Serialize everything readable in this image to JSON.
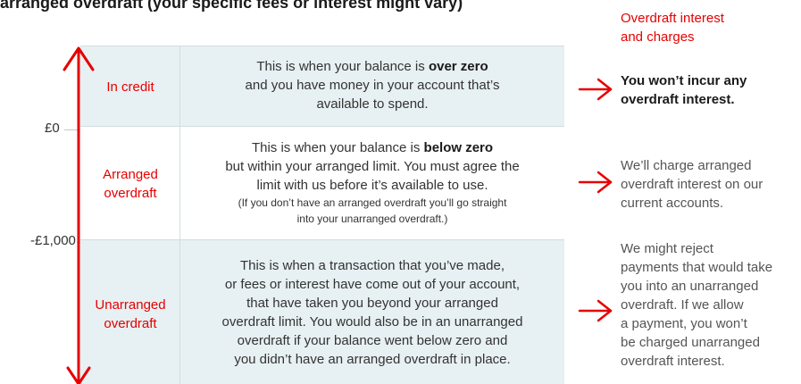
{
  "heading": "arranged overdraft (your specific fees or interest might vary)",
  "column_header": {
    "lines": [
      "Overdraft interest",
      "and charges"
    ]
  },
  "axis": {
    "zero_label": "£0",
    "limit_label": "-£1,000"
  },
  "rows": [
    {
      "label_lines": [
        "In credit"
      ],
      "desc_lines": [
        [
          "This is when your balance is ",
          "over zero"
        ],
        [
          "and you have money in your account that’s"
        ],
        [
          "available to spend."
        ]
      ],
      "outcome_lines": [
        "You won’t incur any",
        "overdraft interest."
      ]
    },
    {
      "label_lines": [
        "Arranged",
        "overdraft"
      ],
      "desc_lines": [
        [
          "This is when your balance is ",
          "below zero"
        ],
        [
          "but within your arranged limit. You must agree the"
        ],
        [
          "limit with us before it’s available to use."
        ]
      ],
      "note_lines": [
        "(If you don’t have an arranged overdraft you’ll go straight",
        "into your unarranged overdraft.)"
      ],
      "outcome_lines": [
        "We’ll charge arranged",
        "overdraft interest on our",
        "current accounts."
      ]
    },
    {
      "label_lines": [
        "Unarranged",
        "overdraft"
      ],
      "desc_lines": [
        [
          "This is when a transaction that you’ve made,"
        ],
        [
          "or fees or interest have come out of your account,"
        ],
        [
          "that have taken you beyond your arranged"
        ],
        [
          "overdraft limit. You would also be in an unarranged"
        ],
        [
          "overdraft if your balance went below zero and"
        ],
        [
          "you didn’t have an arranged overdraft in place."
        ]
      ],
      "outcome_lines": [
        "We might reject",
        "payments that would take",
        "you into an unarranged",
        "overdraft. If we allow",
        "a payment, you won’t",
        "be charged unarranged",
        "overdraft interest."
      ]
    }
  ],
  "colors": {
    "accent_red": "#e60000",
    "band_blue": "#e7f0f3"
  },
  "icons": [
    "vertical-double-arrow-icon",
    "right-arrow-icon"
  ]
}
